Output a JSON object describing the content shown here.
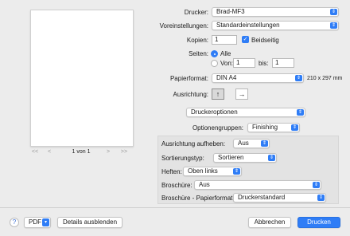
{
  "preview": {
    "prev_first_label": "<<",
    "prev_label": "<",
    "page_label": "1 von 1",
    "next_label": ">",
    "next_last_label": ">>"
  },
  "printer": {
    "label": "Drucker:",
    "value": "Brad-MF3"
  },
  "presets": {
    "label": "Voreinstellungen:",
    "value": "Standardeinstellungen"
  },
  "copies": {
    "label": "Kopien:",
    "value": "1",
    "duplex_label": "Beidseitig",
    "duplex_checked": true
  },
  "pages": {
    "label": "Seiten:",
    "all_label": "Alle",
    "from_label": "Von:",
    "from_value": "1",
    "to_label": "bis:",
    "to_value": "1"
  },
  "paper": {
    "label": "Papierformat:",
    "value": "DIN A4",
    "dimensions": "210 x 297 mm"
  },
  "orientation": {
    "label": "Ausrichtung:",
    "portrait_icon": "portrait-person-icon",
    "landscape_icon": "landscape-person-icon"
  },
  "section": {
    "value": "Druckeroptionen"
  },
  "option_groups": {
    "label": "Optionengruppen:",
    "value": "Finishing"
  },
  "finishing": {
    "rotate_label": "Ausrichtung aufheben:",
    "rotate_value": "Aus",
    "sort_label": "Sortierungstyp:",
    "sort_value": "Sortieren",
    "staple_label": "Heften:",
    "staple_value": "Oben links",
    "booklet_label": "Broschüre:",
    "booklet_value": "Aus",
    "booklet_paper_label": "Broschüre - Papierformat:",
    "booklet_paper_value": "Druckerstandard"
  },
  "footer": {
    "help_label": "?",
    "pdf_label": "PDF",
    "details_label": "Details ausblenden",
    "cancel_label": "Abbrechen",
    "print_label": "Drucken"
  },
  "colors": {
    "accent": "#2f7df6"
  }
}
